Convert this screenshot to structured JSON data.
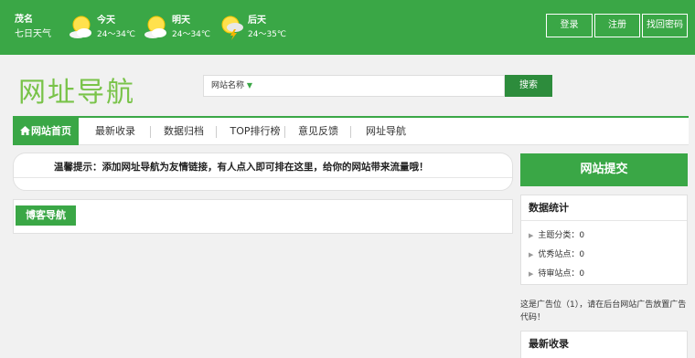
{
  "header": {
    "city": "茂名",
    "forecast_label": "七日天气",
    "days": [
      {
        "label": "今天",
        "temp": "24～34℃",
        "icon": "sun-cloud-icon"
      },
      {
        "label": "明天",
        "temp": "24～34℃",
        "icon": "sun-cloud-icon"
      },
      {
        "label": "后天",
        "temp": "24～35℃",
        "icon": "thunder-sun-icon"
      }
    ],
    "auth": {
      "login": "登录",
      "register": "注册",
      "recover": "找回密码"
    }
  },
  "logo": "网址导航",
  "search": {
    "scope": "网站名称",
    "placeholder": "",
    "button": "搜索"
  },
  "nav": {
    "tabs": [
      "网站首页",
      "最新收录",
      "数据归档",
      "TOP排行榜",
      "意见反馈",
      "网址导航"
    ]
  },
  "notice": "温馨提示：添加网址导航为友情链接，有人点入即可排在这里，给你的网站带来流量哦！",
  "blog_nav": {
    "title": "博客导航"
  },
  "sidebar": {
    "submit": "网站提交",
    "stats": {
      "title": "数据统计",
      "items": [
        "主题分类：0",
        "优秀站点：0",
        "待审站点：0"
      ]
    },
    "ad": "这是广告位（1），请在后台网站广告放置广告代码！",
    "recent_title": "最新收录"
  },
  "colors": {
    "brand": "#3aa746",
    "logo": "#79c349",
    "search_button": "#2d8c3c"
  }
}
